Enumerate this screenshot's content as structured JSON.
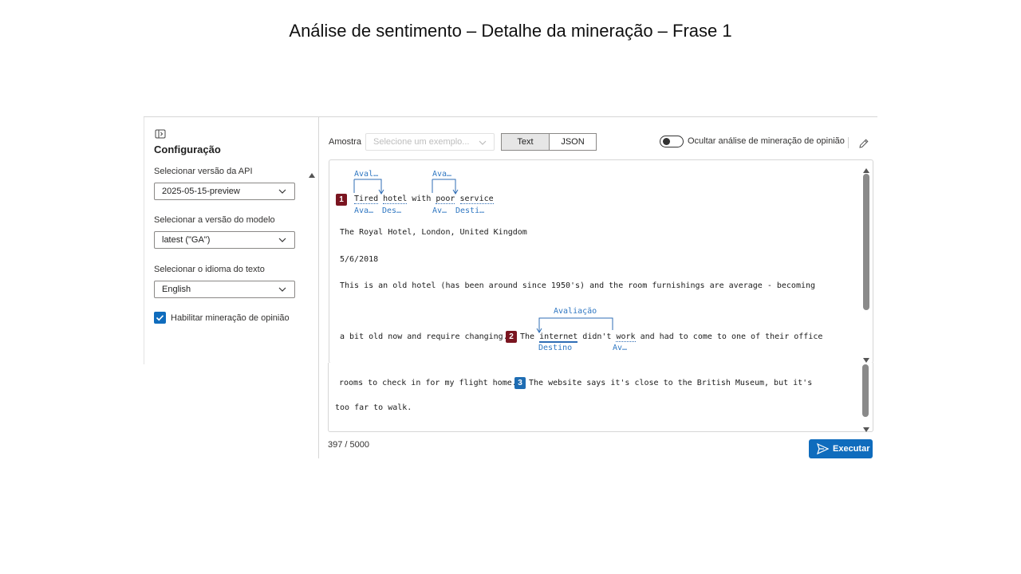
{
  "slide_title": "Análise de sentimento – Detalhe da mineração – Frase 1",
  "config": {
    "title": "Configuração",
    "api_label": "Selecionar versão da API",
    "api_value": "2025-05-15-preview",
    "model_label": "Selecionar a versão do modelo",
    "model_value": "latest (\"GA\")",
    "lang_label": "Selecionar o idioma do texto",
    "lang_value": "English",
    "opinion_checkbox_label": "Habilitar mineração de opinião",
    "opinion_checked": true
  },
  "toolbar": {
    "sample_label": "Amostra",
    "sample_placeholder": "Selecione um exemplo...",
    "text_tab": "Text",
    "json_tab": "JSON",
    "hide_toggle_label": "Ocultar análise de mineração de opinião"
  },
  "result": {
    "s1": {
      "badge": "1",
      "w1": "Tired",
      "w2": "hotel",
      "mid": " with ",
      "w3": "poor",
      "w4": "service",
      "top1": "Aval…",
      "top2": "Ava…",
      "sub1": "Ava…",
      "sub2": "Des…",
      "sub3": "Av…",
      "sub4": "Desti…"
    },
    "line_place": "The Royal Hotel, London, United Kingdom",
    "line_date": "5/6/2018",
    "line_desc": "This is an old hotel (has been around since 1950's) and the room furnishings are average - becoming",
    "s2": {
      "pre": "a bit old now and require changing.",
      "badge": "2",
      "the": "The",
      "w1": "internet",
      "mid": "didn't",
      "w2": "work",
      "post": "and had to come to one of their office",
      "top": "Avaliação",
      "sub1": "Destino",
      "sub2": "Av…"
    }
  },
  "input": {
    "line1_pre": "rooms to check in for my flight home.",
    "badge": "3",
    "line1_post": "The website says it's close to the British Museum, but it's",
    "line2": "too far to walk."
  },
  "footer": {
    "char_count": "397 / 5000",
    "run_button": "Executar"
  },
  "colors": {
    "accent": "#0f6cbd",
    "badge_red": "#7a1520",
    "badge_blue": "#1f6db3",
    "tag_blue": "#2f77c2"
  }
}
